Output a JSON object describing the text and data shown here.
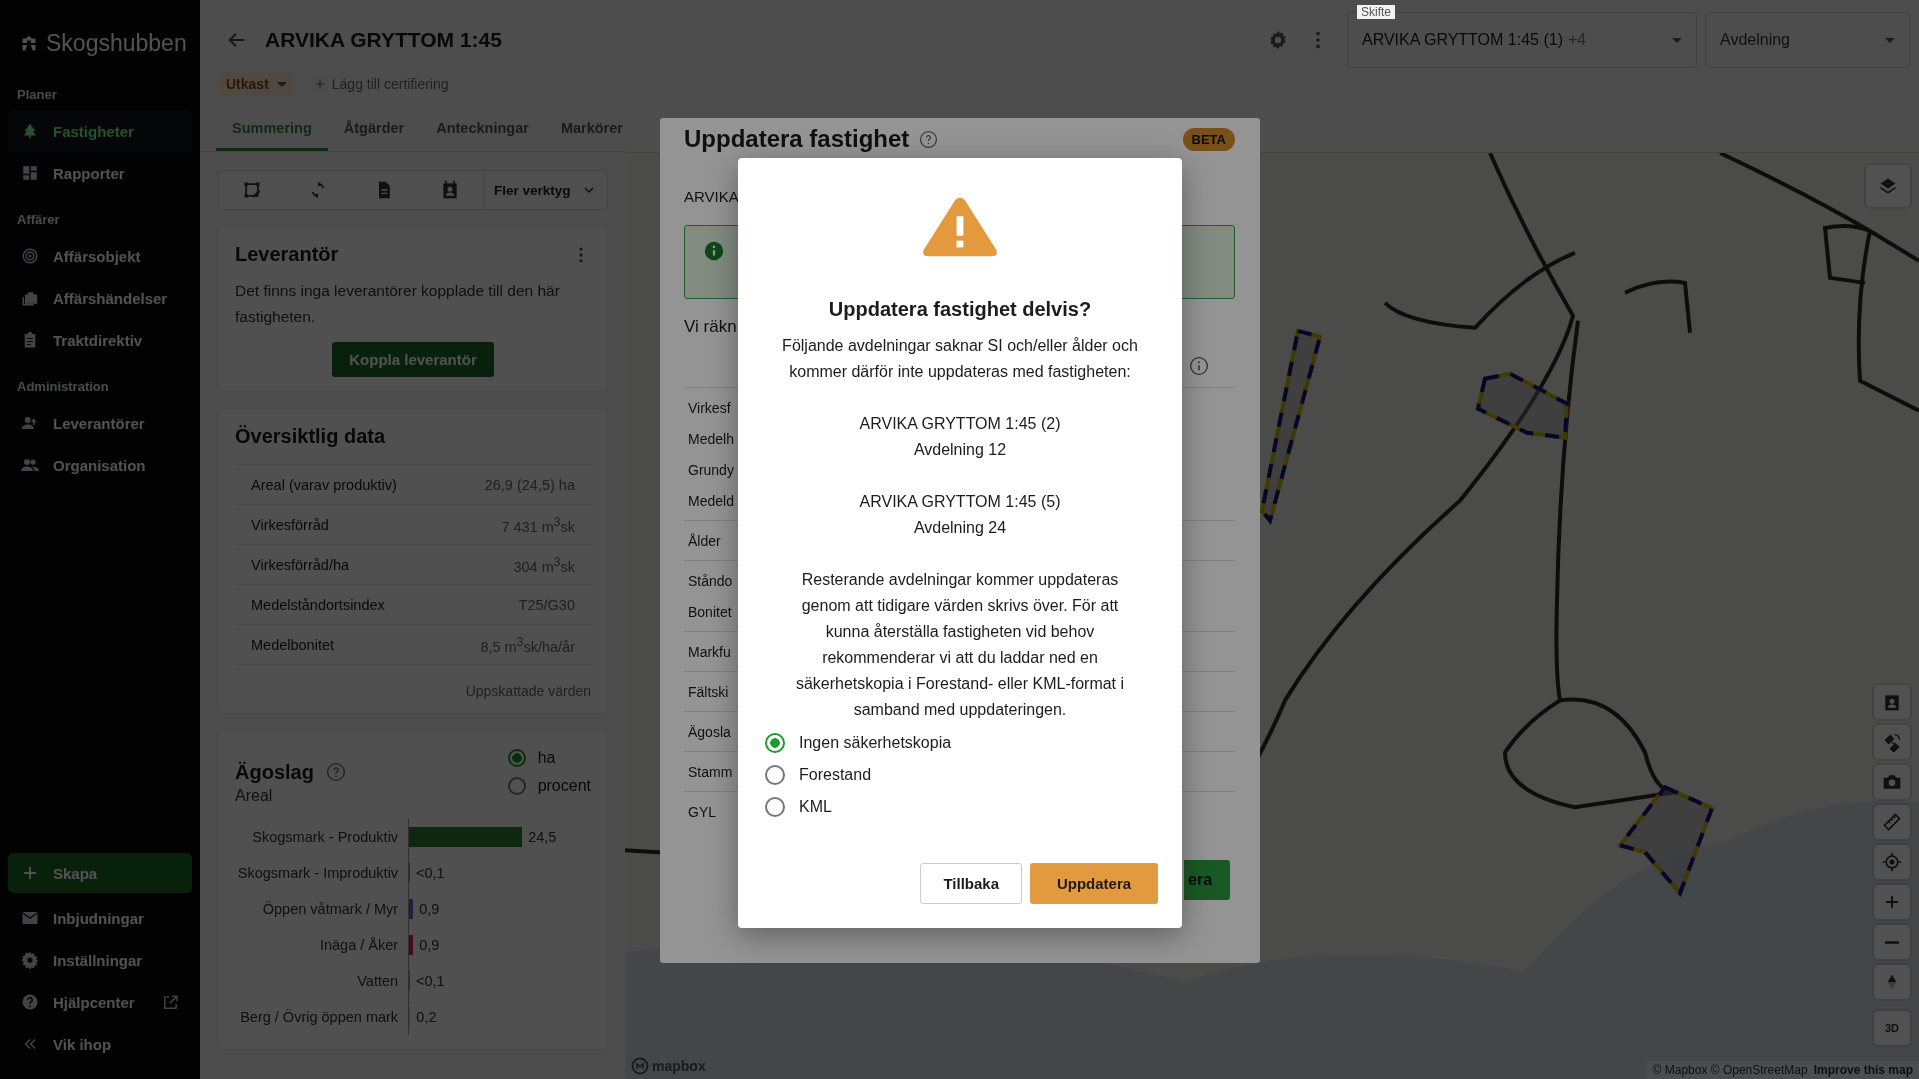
{
  "sidebar": {
    "logo": "Skogshubben",
    "sections": [
      {
        "heading": "Planer",
        "items": [
          {
            "label": "Fastigheter",
            "selected": true
          },
          {
            "label": "Rapporter",
            "selected": false
          }
        ]
      },
      {
        "heading": "Affärer",
        "items": [
          {
            "label": "Affärsobjekt",
            "selected": false
          },
          {
            "label": "Affärshändelser",
            "selected": false
          },
          {
            "label": "Traktdirektiv",
            "selected": false
          }
        ]
      },
      {
        "heading": "Administration",
        "items": [
          {
            "label": "Leverantörer",
            "selected": false
          },
          {
            "label": "Organisation",
            "selected": false
          }
        ]
      }
    ],
    "create_button": "Skapa",
    "bottom_items": [
      {
        "label": "Inbjudningar",
        "external": false
      },
      {
        "label": "Inställningar",
        "external": false
      },
      {
        "label": "Hjälpcenter",
        "external": true
      }
    ],
    "collapse": "Vik ihop"
  },
  "header": {
    "title": "ARVIKA GRYTTOM 1:45",
    "status": "Utkast",
    "add_certification": "Lägg till certifiering",
    "tabs": [
      {
        "label": "Summering",
        "selected": true
      },
      {
        "label": "Åtgärder",
        "selected": false
      },
      {
        "label": "Anteckningar",
        "selected": false
      },
      {
        "label": "Markörer",
        "selected": false
      }
    ],
    "skifte": {
      "label": "Skifte",
      "value": "ARVIKA GRYTTOM 1:45 (1)",
      "extra": "+4"
    },
    "avdelning": {
      "placeholder": "Avdelning"
    }
  },
  "toolbar": {
    "more_tools": "Fler verktyg"
  },
  "supplier_card": {
    "title": "Leverantör",
    "text": "Det finns inga leverantörer kopplade till den här fastigheten.",
    "button": "Koppla leverantör"
  },
  "overview_card": {
    "title": "Översiktlig data",
    "rows": [
      {
        "label": "Areal (varav produktiv)",
        "value": "26,9 (24,5) ha"
      },
      {
        "label": "Virkesförråd",
        "value": "7 431 m$^{3}$sk"
      },
      {
        "label": "Virkesförråd/ha",
        "value": "304 m$^{3}$sk"
      },
      {
        "label": "Medelståndortsindex",
        "value": "T25/G30"
      },
      {
        "label": "Medelbonitet",
        "value": "8,5 m$^{3}$sk/ha/år"
      }
    ],
    "footnote": "Uppskattade värden"
  },
  "land_use_card": {
    "title": "Ägoslag",
    "units": [
      {
        "label": "ha",
        "selected": true
      },
      {
        "label": "procent",
        "selected": false
      }
    ],
    "subtitle": "Areal",
    "rows": [
      {
        "label": "Skogsmark - Produktiv",
        "value": "24,5",
        "level": 0.565,
        "color": "#0f2810"
      },
      {
        "label": "Skogsmark - Improduktiv",
        "value": "<0,1",
        "level": 0.004,
        "color": "#2d2d2d"
      },
      {
        "label": "Öppen våtmark / Myr",
        "value": "0,9",
        "level": 0.02,
        "color": "#1d223d"
      },
      {
        "label": "Inäga / Åker",
        "value": "0,9",
        "level": 0.02,
        "color": "#45091f"
      },
      {
        "label": "Vatten",
        "value": "<0,1",
        "level": 0.004,
        "color": "#2d2d2d"
      },
      {
        "label": "Berg / Övrig öppen mark",
        "value": "0,2",
        "level": 0.006,
        "color": "#514511"
      }
    ]
  },
  "map": {
    "logo": "mapbox",
    "attribution": "© Mapbox © OpenStreetMap",
    "improve": "Improve this map",
    "three_d": "3D"
  },
  "update_modal": {
    "title": "Uppdatera fastighet",
    "badge": "BETA",
    "subtitle": "ARVIKA",
    "intro": "Vi räkn",
    "row_groups": [
      [
        "Virkesf",
        "Medelh",
        "Grundy",
        "Medeld"
      ],
      [
        "Ålder"
      ],
      [
        "Ståndo",
        "Bonitet"
      ],
      [
        "Markfu"
      ],
      [
        "Fältski"
      ],
      [
        "Ägosla"
      ],
      [
        "Stamm"
      ],
      [
        "GYL"
      ]
    ],
    "button": "era"
  },
  "confirm_dialog": {
    "title": "Uppdatera fastighet delvis?",
    "message": "Följande avdelningar saknar SI och/eller ålder och kommer därför inte uppdateras med fastigheten:",
    "entries": [
      {
        "name": "ARVIKA GRYTTOM 1:45 (2)",
        "section": "Avdelning 12"
      },
      {
        "name": "ARVIKA GRYTTOM 1:45 (5)",
        "section": "Avdelning 24"
      }
    ],
    "note": "Resterande avdelningar kommer uppdateras genom att tidigare värden skrivs över. För att kunna återställa fastigheten vid behov rekommenderar vi att du laddar ned en säkerhetskopia i Forestand- eller KML-format i samband med uppdateringen.",
    "backup_options": [
      {
        "label": "Ingen säkerhetskopia",
        "selected": true
      },
      {
        "label": "Forestand",
        "selected": false
      },
      {
        "label": "KML",
        "selected": false
      }
    ],
    "cancel": "Tillbaka",
    "confirm": "Uppdatera"
  }
}
